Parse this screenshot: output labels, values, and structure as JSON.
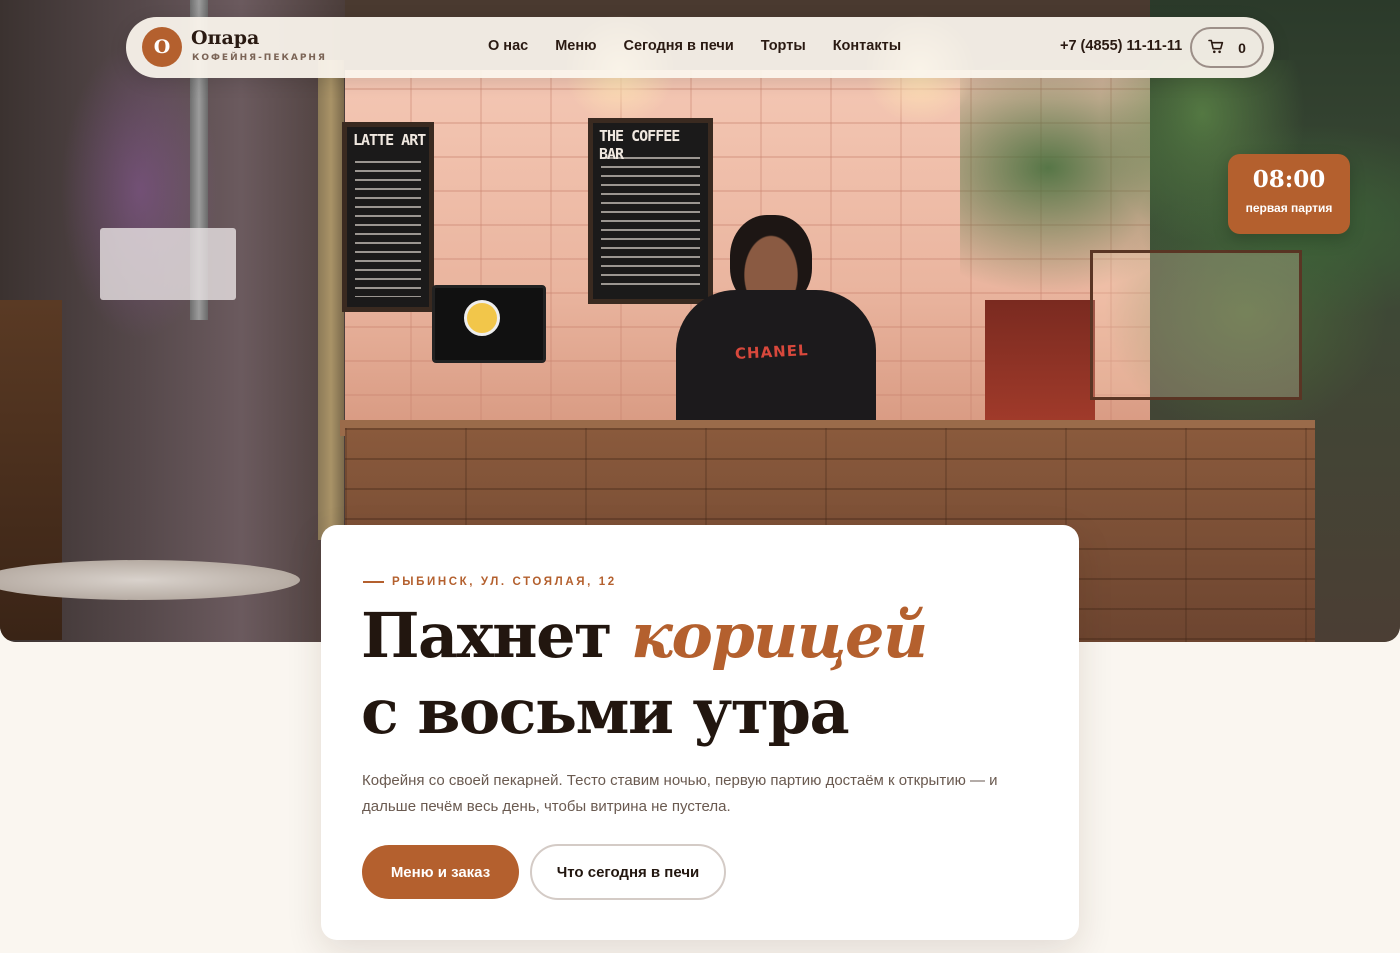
{
  "brand": {
    "mark": "О",
    "name": "Опара",
    "tagline": "КОФЕЙНЯ-ПЕКАРНЯ",
    "accent_color": "#b4602e"
  },
  "nav": {
    "items": [
      {
        "label": "О нас"
      },
      {
        "label": "Меню"
      },
      {
        "label": "Сегодня в печи"
      },
      {
        "label": "Торты"
      },
      {
        "label": "Контакты"
      }
    ],
    "phone": "+7 (4855) 11-11-11",
    "cart": {
      "icon": "cart-icon",
      "count": "0"
    }
  },
  "badge": {
    "time": "08:00",
    "label": "первая партия"
  },
  "hero_photo": {
    "board_left_title": "LATTE ART",
    "board_right_title": "THE COFFEE BAR",
    "shirt_text": "CHANEL"
  },
  "card": {
    "eyebrow": "РЫБИНСК, УЛ. СТОЯЛАЯ, 12",
    "headline_part1": "Пахнет ",
    "headline_accent": "корицей",
    "headline_part2": "с восьми утра",
    "lead": "Кофейня со своей пекарней. Тесто ставим ночью, первую партию достаём к открытию — и дальше печём весь день, чтобы витрина не пустела.",
    "primary_button": "Меню и заказ",
    "secondary_button": "Что сегодня в печи"
  }
}
